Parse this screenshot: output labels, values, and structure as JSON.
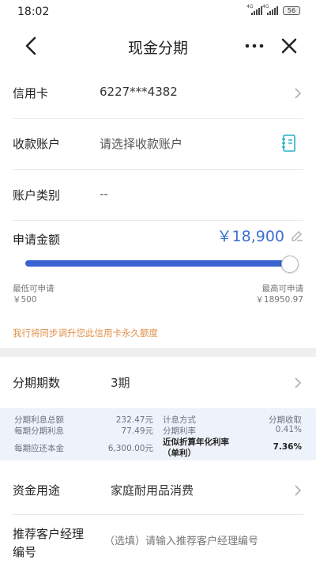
{
  "status": {
    "time": "18:02",
    "sim1": "4G",
    "sim2": "4G",
    "battery": "56"
  },
  "nav": {
    "title": "现金分期"
  },
  "card": {
    "label": "信用卡",
    "number": "6227***4382"
  },
  "payee": {
    "label": "收款账户",
    "placeholder": "请选择收款账户"
  },
  "account_type": {
    "label": "账户类别",
    "value": "--"
  },
  "amount": {
    "label": "申请金额",
    "value": "￥18,900",
    "level_fraction": 0.997
  },
  "slider": {
    "min_label": "最低可申请",
    "min_value": "￥500",
    "max_label": "最高可申请",
    "max_value": "￥18950.97"
  },
  "notice": "我行将同步调升您此信用卡永久额度",
  "period": {
    "label": "分期期数",
    "value": "3期"
  },
  "info": {
    "total_interest_label": "分期利息总额",
    "total_interest_value": "232.47元",
    "per_interest_label": "每期分期利息",
    "per_interest_value": "77.49元",
    "per_principal_label": "每期应还本金",
    "per_principal_value": "6,300.00元",
    "method_label": "计息方式",
    "method_value": "分期收取",
    "rate_label": "分期利率",
    "rate_value": "0.41%",
    "apr_label": "近似折算年化利率",
    "apr_sub": "（单利）",
    "apr_value": "7.36%"
  },
  "usage": {
    "label": "资金用途",
    "value": "家庭耐用品消费"
  },
  "manager": {
    "label_line1": "推荐客户经理",
    "label_line2": "编号",
    "placeholder": "（选填）请输入推荐客户经理编号"
  },
  "colors": {
    "accent": "#3a62d0",
    "amount": "#3d6fd1",
    "notice": "#e0904a",
    "info_bg": "#eef3fb"
  }
}
